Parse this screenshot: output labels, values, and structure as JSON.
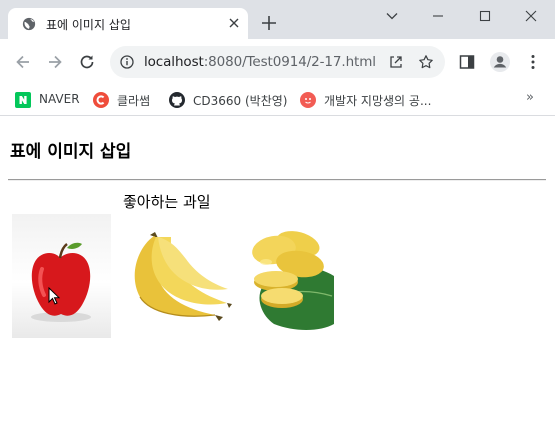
{
  "window": {
    "tab_title": "표에 이미지 삽입",
    "tab_favicon": "globe-icon",
    "controls": [
      "caret-down-icon",
      "minimize-icon",
      "maximize-icon",
      "close-icon"
    ]
  },
  "toolbar": {
    "url_host": "localhost",
    "url_rest": ":8080/Test0914/2-17.html",
    "icons": [
      "back-icon",
      "forward-icon",
      "reload-icon",
      "info-icon",
      "share-icon",
      "star-icon",
      "side-panel-icon",
      "profile-icon",
      "menu-icon"
    ]
  },
  "bookmarks": {
    "items": [
      {
        "label": "NAVER",
        "icon": "naver-icon",
        "color": "#03c75a"
      },
      {
        "label": "클라썸",
        "icon": "classum-icon",
        "color": "#ef4d3b"
      },
      {
        "label": "CD3660 (박찬영)",
        "icon": "github-icon",
        "color": "#24292f"
      },
      {
        "label": "개발자 지망생의 공...",
        "icon": "blog-icon",
        "color": "#f25c54"
      }
    ],
    "more": "»"
  },
  "page": {
    "heading": "표에 이미지 삽입",
    "caption": "좋아하는 과일",
    "images": [
      {
        "name": "apple",
        "color": "#d7181c"
      },
      {
        "name": "banana",
        "color": "#f1d24a"
      },
      {
        "name": "mango",
        "color": "#f0cf44"
      }
    ]
  }
}
